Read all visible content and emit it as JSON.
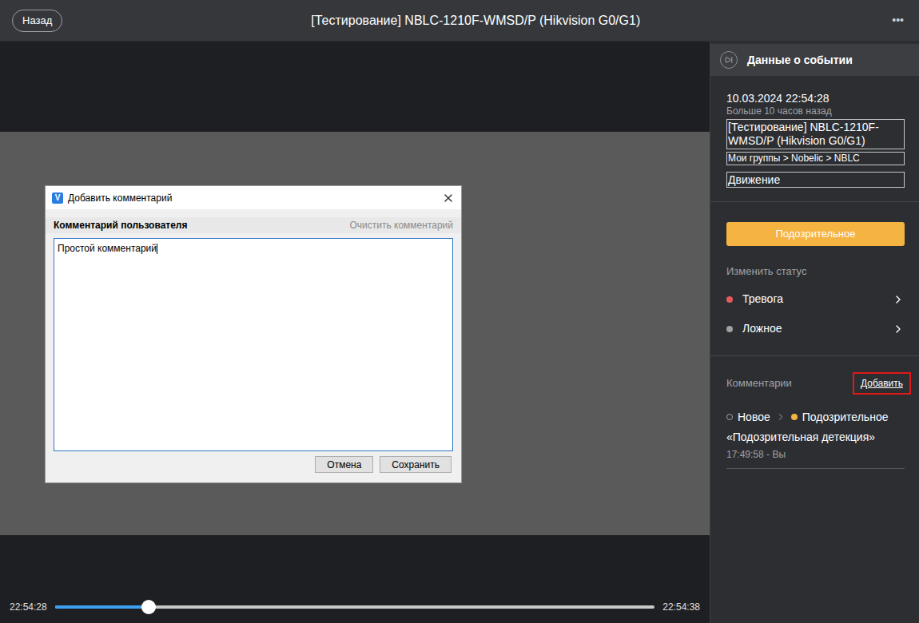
{
  "window": {
    "title": "[Тестирование] NBLC-1210F-WMSD/P (Hikvision G0/G1)",
    "back_button": "Назад",
    "menu": "•••"
  },
  "timeline": {
    "start": "22:54:28",
    "end": "22:54:38",
    "level": 0.156
  },
  "event_panel": {
    "header": "Данные о событии",
    "datetime": "10.03.2024 22:54:28",
    "relative": "Больше 10 часов назад",
    "camera": "[Тестирование] NBLC-1210F-WMSD/P (Hikvision G0/G1)",
    "path": "Мои группы > Nobelic > NBLC",
    "type": "Движение"
  },
  "status_button": {
    "label": "Подозрительное",
    "color": "#f5b342"
  },
  "change_status": {
    "label": "Изменить статус",
    "statuses": [
      {
        "label": "Тревога",
        "color": "#e85a5a"
      },
      {
        "label": "Ложное",
        "color": "#a0a0a0"
      }
    ]
  },
  "comments": {
    "label": "Комментарии",
    "add": "Добавить",
    "add_highlighted": true,
    "entries": [
      {
        "from": "Новое",
        "from_color": "#a0a0a0",
        "to": "Подозрительное",
        "to_color": "#f5b342",
        "text": "«Подозрительная детекция»",
        "meta": "17:49:58 - Вы"
      }
    ]
  },
  "dialog": {
    "logo": "V",
    "title": "Добавить комментарий",
    "section": "Комментарий пользователя",
    "clear": "Очистить комментарий",
    "value": "Простой комментарий",
    "buttons": [
      "Отмена",
      "Сохранить"
    ]
  }
}
